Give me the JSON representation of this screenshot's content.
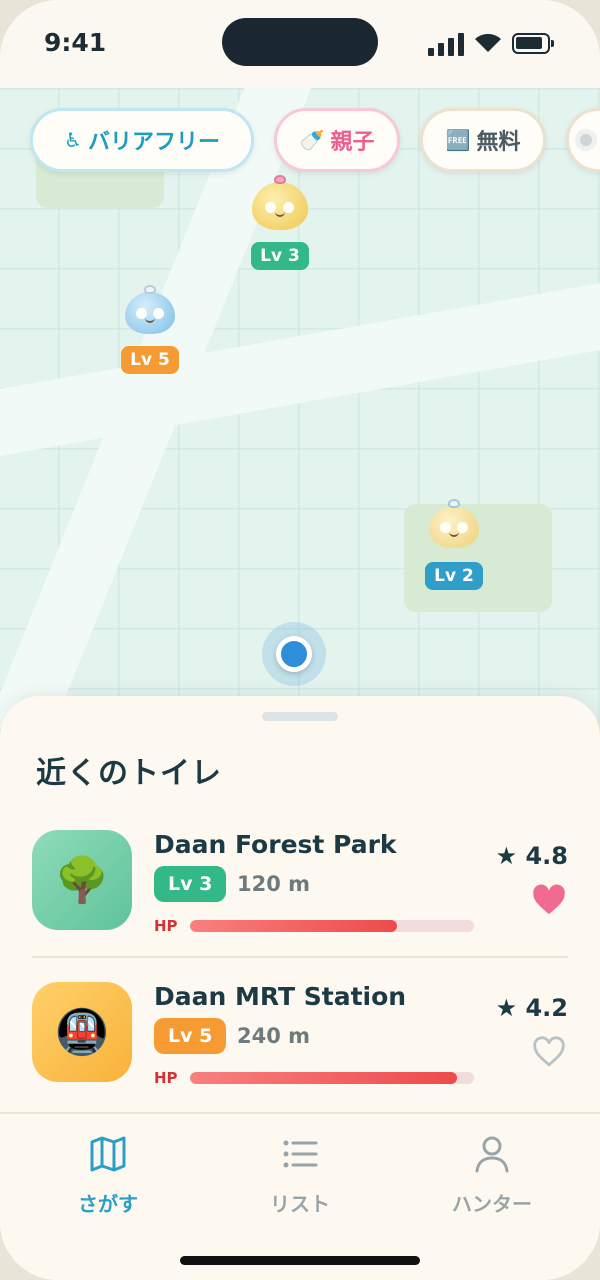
{
  "status": {
    "time": "9:41"
  },
  "filters": [
    {
      "icon": "♿",
      "label": "バリアフリー",
      "color": "#1f9cc2",
      "border": "#bfe6f1",
      "active": true
    },
    {
      "icon": "🍼",
      "label": "親子",
      "color": "#f05c8e",
      "border": "#f8c8d6",
      "active": false
    },
    {
      "icon": "🆓",
      "label": "無料",
      "color": "#4a5a60",
      "border": "#ece1cc",
      "active": false
    }
  ],
  "pins": [
    {
      "level_label": "Lv 3",
      "badge_color": "#33b888",
      "slime_color": "#f4d36a"
    },
    {
      "level_label": "Lv 5",
      "badge_color": "#f69b34",
      "slime_color": "#8ac9ea"
    },
    {
      "level_label": "Lv 2",
      "badge_color": "#2f9ec8",
      "slime_color": "#f3d88e"
    }
  ],
  "sheet": {
    "title": "近くのトイレ",
    "items": [
      {
        "name": "Daan Forest Park",
        "level": "Lv 3",
        "level_color": "#33b888",
        "distance": "120 m",
        "hp_label": "HP",
        "hp": 0.73,
        "rating": "★ 4.8",
        "favorite": true,
        "thumb_icon": "🌳",
        "thumb_bg": "#7fd1ad"
      },
      {
        "name": "Daan MRT Station",
        "level": "Lv 5",
        "level_color": "#f69b34",
        "distance": "240 m",
        "hp_label": "HP",
        "hp": 0.94,
        "rating": "★ 4.2",
        "favorite": false,
        "thumb_icon": "🚇",
        "thumb_bg": "#fcbf4a"
      }
    ]
  },
  "tabs": [
    {
      "label": "さがす",
      "icon": "map-icon",
      "active": true
    },
    {
      "label": "リスト",
      "icon": "list-icon",
      "active": false
    },
    {
      "label": "ハンター",
      "icon": "user-icon",
      "active": false
    }
  ],
  "colors": {
    "accent": "#2a9fc6",
    "inactive": "#98a4a8",
    "text": "#1d3a44",
    "heart": "#f06a92"
  }
}
